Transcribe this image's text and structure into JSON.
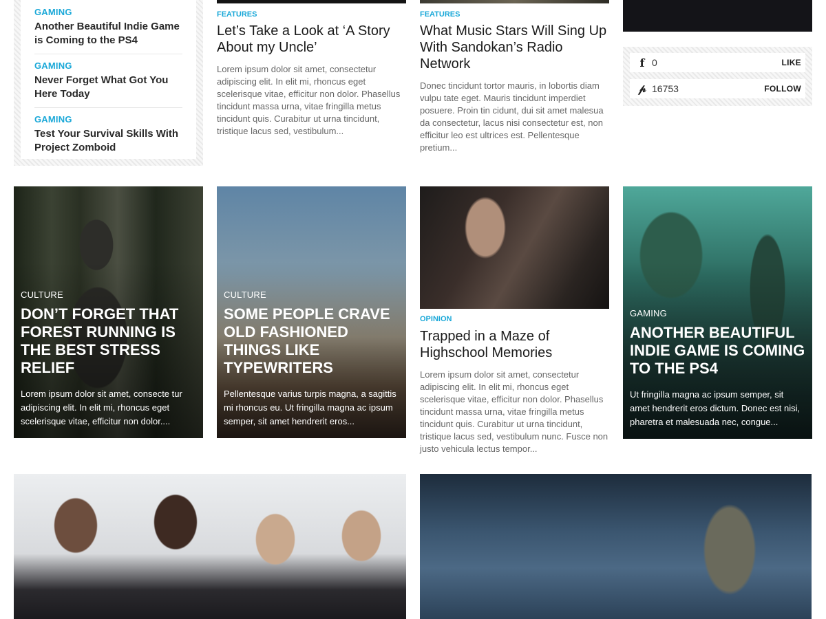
{
  "widget_list": {
    "items": [
      {
        "category": "GAMING",
        "title": "Another Beautiful Indie Game is Coming to the PS4"
      },
      {
        "category": "GAMING",
        "title": "Never Forget What Got You Here Today"
      },
      {
        "category": "GAMING",
        "title": "Test Your Survival Skills With Project Zomboid"
      }
    ]
  },
  "top_articles": [
    {
      "category": "FEATURES",
      "title": "Let’s Take a Look at ‘A Story About my Uncle’",
      "excerpt": "Lorem ipsum dolor sit amet, consectetur adipiscing elit. In elit mi, rhoncus eget scelerisque vitae, efficitur non dolor. Phasellus tincidunt massa urna, vitae fringilla metus tincidunt quis. Curabitur ut urna tincidunt, tristique lacus sed, vestibulum..."
    },
    {
      "category": "FEATURES",
      "title": "What Music Stars Will Sing Up With Sandokan’s Radio Network",
      "excerpt": "Donec tincidunt tortor mauris, in lobortis diam vulpu tate eget. Mauris tincidunt imperdiet posuere. Proin tin cidunt, dui sit amet malesua da consectetur, lacus nisi consectetur est, non efficitur leo est ultrices est. Pellentesque pretium..."
    }
  ],
  "social": {
    "facebook": {
      "icon": "facebook-icon",
      "count": "0",
      "action": "LIKE"
    },
    "pinterest": {
      "icon": "pinterest-icon",
      "count": "16753",
      "action": "FOLLOW"
    }
  },
  "overlay_cards": [
    {
      "category": "CULTURE",
      "title": "DON’T FORGET THAT FOREST RUNNING IS THE BEST STRESS RELIEF",
      "excerpt": "Lorem ipsum dolor sit amet, consecte tur adipiscing elit. In elit mi, rhoncus eget scelerisque vitae, efficitur non dolor...."
    },
    {
      "category": "CULTURE",
      "title": "SOME PEOPLE CRAVE OLD FASHIONED THINGS LIKE TYPEWRITERS",
      "excerpt": "Pellentesque varius turpis magna, a sagittis mi rhoncus eu. Ut fringilla magna ac ipsum semper, sit amet hendrerit eros..."
    },
    {
      "category": "GAMING",
      "title": "ANOTHER BEAUTIFUL INDIE GAME IS COMING TO THE PS4",
      "excerpt": "Ut fringilla magna ac ipsum semper, sit amet hendrerit eros dictum. Donec est nisi, pharetra et malesuada nec, congue..."
    }
  ],
  "image_article": {
    "category": "OPINION",
    "title": "Trapped in a Maze of Highschool Memories",
    "excerpt": "Lorem ipsum dolor sit amet, consectetur adipiscing elit. In elit mi, rhoncus eget scelerisque vitae, efficitur non dolor. Phasellus tincidunt massa urna, vitae fringilla metus tincidunt quis. Curabitur ut urna tincidunt, tristique lacus sed, vestibulum nunc. Fusce non justo vehicula lectus tempor..."
  }
}
